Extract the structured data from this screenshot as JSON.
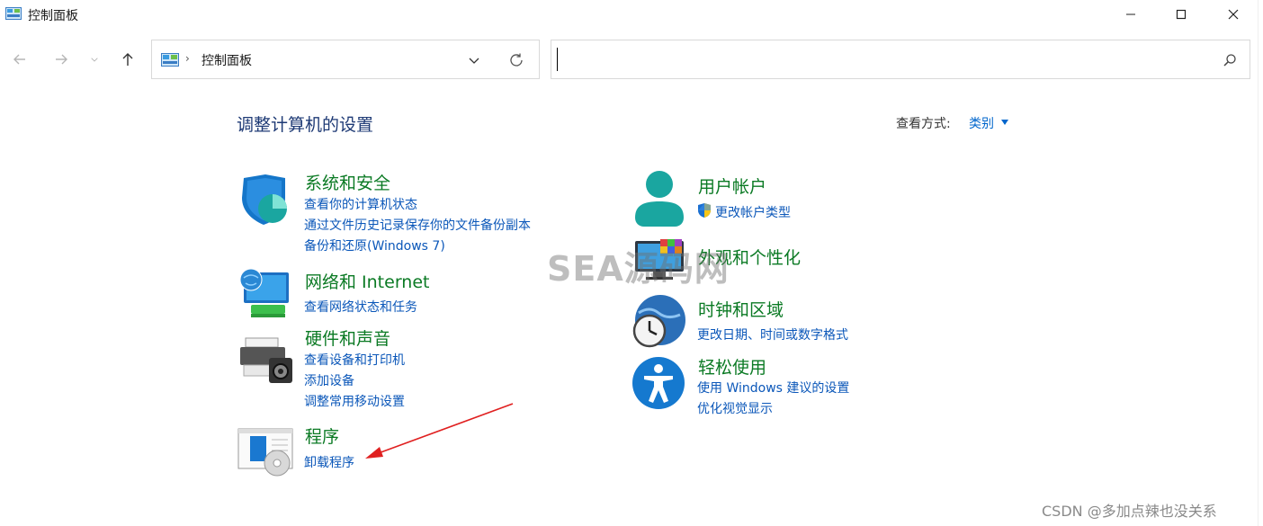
{
  "window": {
    "title": "控制面板"
  },
  "address": {
    "crumb": "控制面板"
  },
  "search": {
    "value": ""
  },
  "main": {
    "title": "调整计算机的设置",
    "view_by_label": "查看方式:",
    "view_by_value": "类别"
  },
  "categories": {
    "system": {
      "title": "系统和安全",
      "links": [
        "查看你的计算机状态",
        "通过文件历史记录保存你的文件备份副本",
        "备份和还原(Windows 7)"
      ]
    },
    "network": {
      "title": "网络和 Internet",
      "links": [
        "查看网络状态和任务"
      ]
    },
    "hardware": {
      "title": "硬件和声音",
      "links": [
        "查看设备和打印机",
        "添加设备",
        "调整常用移动设置"
      ]
    },
    "programs": {
      "title": "程序",
      "links": [
        "卸载程序"
      ]
    },
    "users": {
      "title": "用户帐户",
      "links": [
        "更改帐户类型"
      ]
    },
    "appearance": {
      "title": "外观和个性化",
      "links": []
    },
    "clock": {
      "title": "时钟和区域",
      "links": [
        "更改日期、时间或数字格式"
      ]
    },
    "ease": {
      "title": "轻松使用",
      "links": [
        "使用 Windows 建议的设置",
        "优化视觉显示"
      ]
    }
  },
  "watermark": "SEA源码网",
  "credit": "CSDN @多加点辣也没关系",
  "colors": {
    "category_title": "#0b7a24",
    "link": "#0b57b9",
    "page_title": "#1e3a75",
    "annotation_arrow": "#e02020"
  }
}
